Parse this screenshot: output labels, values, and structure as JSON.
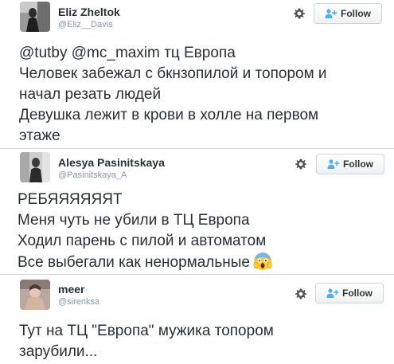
{
  "tweets": [
    {
      "name": "Eliz Zheltok",
      "handle": "@Eliz__Davis",
      "follow_label": "Follow",
      "lines": [
        "@tutby @mc_maxim  тц Европа",
        "Человек забежал с бкнзопилой и топором и",
        "начал резать людей",
        "Девушка лежит в крови в холле на первом",
        "этаже"
      ]
    },
    {
      "name": "Alesya Pasinitskaya",
      "handle": "@Pasinitskaya_A",
      "follow_label": "Follow",
      "lines": [
        "РЕБЯЯЯЯЯЯТ",
        "Меня чуть не убили в ТЦ Европа",
        "Ходил парень с пилой и автоматом",
        "Все выбегали как ненормальные"
      ],
      "emoji": "scream-face-icon"
    },
    {
      "name": "meer",
      "handle": "@sirenksa",
      "follow_label": "Follow",
      "lines": [
        "Тут на ТЦ \"Европа\" мужика топором",
        "зарубили..."
      ]
    }
  ],
  "colors": {
    "name": "#292f33",
    "handle": "#8899a6",
    "follow_icon": "#55acee",
    "divider": "#d6d6d6"
  }
}
